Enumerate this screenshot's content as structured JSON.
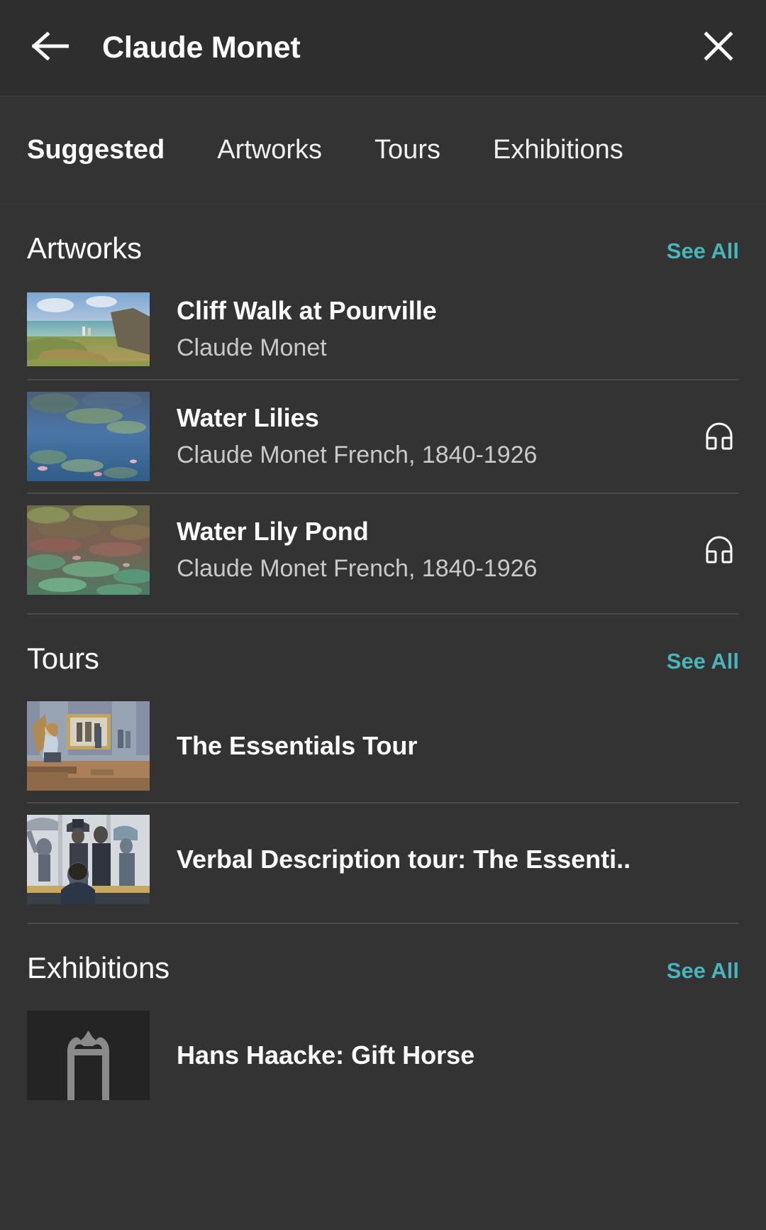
{
  "header": {
    "back_icon": "arrow-left-icon",
    "title": "Claude Monet",
    "close_icon": "close-icon"
  },
  "tabs": [
    {
      "label": "Suggested",
      "active": true
    },
    {
      "label": "Artworks",
      "active": false
    },
    {
      "label": "Tours",
      "active": false
    },
    {
      "label": "Exhibitions",
      "active": false
    }
  ],
  "colors": {
    "accent": "#49b4ba",
    "background": "#333333",
    "header_background": "#2e2e2e",
    "divider": "#4a4a4a",
    "title_text": "#ffffff",
    "subtitle_text": "#c9c9c9"
  },
  "sections": [
    {
      "id": "artworks",
      "title": "Artworks",
      "see_all_label": "See All",
      "items": [
        {
          "title": "Cliff Walk at Pourville",
          "subtitle": "Claude Monet",
          "thumb": "cliff-walk-thumbnail",
          "audio": false
        },
        {
          "title": "Water Lilies",
          "subtitle": "Claude Monet French, 1840-1926",
          "thumb": "water-lilies-thumbnail",
          "audio": true
        },
        {
          "title": "Water Lily Pond",
          "subtitle": "Claude Monet French, 1840-1926",
          "thumb": "water-lily-pond-thumbnail",
          "audio": true
        }
      ]
    },
    {
      "id": "tours",
      "title": "Tours",
      "see_all_label": "See All",
      "items": [
        {
          "title": "The Essentials Tour",
          "subtitle": "",
          "thumb": "essentials-tour-thumbnail",
          "audio": false
        },
        {
          "title": "Verbal Description tour: The Essenti..",
          "subtitle": "",
          "thumb": "verbal-description-tour-thumbnail",
          "audio": false
        }
      ]
    },
    {
      "id": "exhibitions",
      "title": "Exhibitions",
      "see_all_label": "See All",
      "items": [
        {
          "title": "Hans Haacke: Gift Horse",
          "subtitle": "",
          "thumb": "picture-frame-placeholder-thumbnail",
          "audio": false
        }
      ]
    }
  ]
}
